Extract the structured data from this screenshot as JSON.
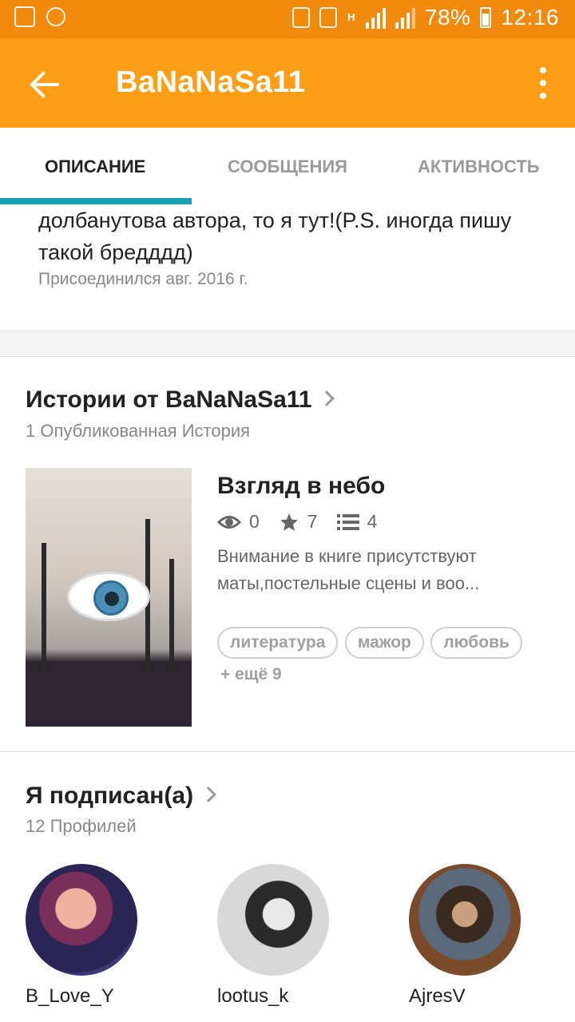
{
  "status_bar": {
    "battery": "78%",
    "time": "12:16",
    "network_label": "H",
    "icons": [
      "image-icon",
      "weather-icon",
      "app-notification-icon",
      "app-notification-icon-2",
      "signal-icon",
      "signal-icon-2",
      "battery-icon"
    ]
  },
  "app_bar": {
    "title": "BaNaNaSa11",
    "back_icon": "arrow-left-icon",
    "menu_icon": "more-vertical-icon",
    "color": "#ff9d14"
  },
  "tabs": [
    {
      "label": "ОПИСАНИЕ",
      "active": true
    },
    {
      "label": "СООБЩЕНИЯ",
      "active": false
    },
    {
      "label": "АКТИВНОСТЬ",
      "active": false
    }
  ],
  "profile": {
    "description": "долбанутова автора, то я тут!(P.S. иногда пишу такой бредддд)",
    "joined": "Присоединился авг. 2016 г."
  },
  "stories_section": {
    "title": "Истории от BaNaNaSa11",
    "subtitle": "1 Опубликованная История",
    "story": {
      "title": "Взгляд в небо",
      "reads": "0",
      "votes": "7",
      "parts": "4",
      "description": "Внимание в книге присутствуют маты,постельные сцены и воо...",
      "tags": [
        "литература",
        "мажор",
        "любовь"
      ],
      "more_tags": "+ ещё 9"
    }
  },
  "following_section": {
    "title": "Я подписан(а)",
    "subtitle": "12 Профилей",
    "profiles": [
      {
        "name": "B_Love_Y"
      },
      {
        "name": "lootus_k"
      },
      {
        "name": "AjresV"
      }
    ]
  },
  "colors": {
    "accent": "#1aa0b3",
    "status_bar": "#f28a0e"
  }
}
